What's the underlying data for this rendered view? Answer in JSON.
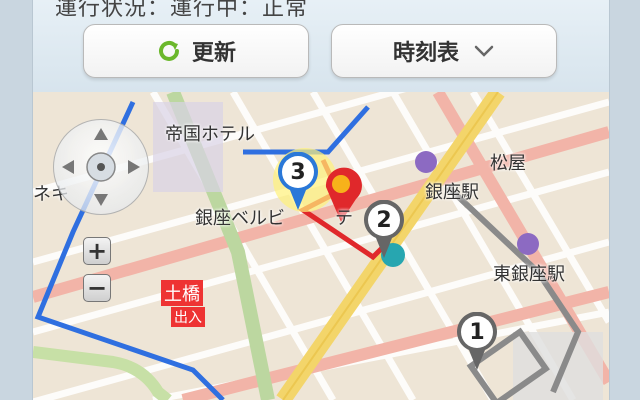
{
  "status": {
    "text": "運行状況：運行中：正常"
  },
  "toolbar": {
    "refresh_label": "更新",
    "timetable_label": "時刻表"
  },
  "map": {
    "labels": {
      "imperial_hotel": "帝国ホテル",
      "matsuya": "松屋",
      "ginza_station": "銀座駅",
      "higashi_ginza_station": "東銀座駅",
      "ginza_bellevue": "銀座ベルビ",
      "ginza_bellevue_tail": "テ",
      "nishi_label": "ネキ",
      "dobashi": "土橋",
      "exit": "出入"
    },
    "markers": {
      "stop_1": "1",
      "stop_2": "2",
      "stop_3": "3"
    }
  },
  "colors": {
    "refresh_icon": "#6bb82c",
    "route_red": "#e0282b",
    "route_blue": "#2f6fe0",
    "route_gray": "#8a8a8a",
    "road_yellow": "#f3d56a",
    "marker_blue": "#2a78d8"
  }
}
